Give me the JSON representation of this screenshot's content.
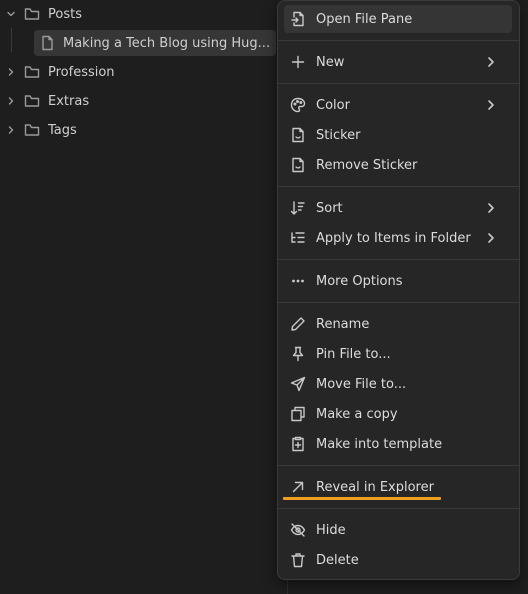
{
  "explorer": {
    "folders": [
      {
        "label": "Posts",
        "expanded": true,
        "icon": "folder-icon"
      },
      {
        "label": "Profession",
        "expanded": false,
        "icon": "folder-icon"
      },
      {
        "label": "Extras",
        "expanded": false,
        "icon": "folder-icon"
      },
      {
        "label": "Tags",
        "expanded": false,
        "icon": "folder-icon"
      }
    ],
    "file": {
      "label": "Making a Tech Blog using Hug...",
      "icon": "file-icon"
    }
  },
  "context_menu": {
    "groups": [
      [
        {
          "label": "Open File Pane",
          "icon": "file-input-icon",
          "highlighted": true
        }
      ],
      [
        {
          "label": "New",
          "icon": "plus-icon",
          "submenu": true
        }
      ],
      [
        {
          "label": "Color",
          "icon": "palette-icon",
          "submenu": true
        },
        {
          "label": "Sticker",
          "icon": "sticker-icon"
        },
        {
          "label": "Remove Sticker",
          "icon": "sticker-icon"
        }
      ],
      [
        {
          "label": "Sort",
          "icon": "sort-icon",
          "submenu": true
        },
        {
          "label": "Apply to Items in Folder",
          "icon": "list-tree-icon",
          "submenu": true
        }
      ],
      [
        {
          "label": "More Options",
          "icon": "more-horizontal-icon"
        }
      ],
      [
        {
          "label": "Rename",
          "icon": "pencil-icon"
        },
        {
          "label": "Pin File to...",
          "icon": "pin-icon"
        },
        {
          "label": "Move File to...",
          "icon": "send-icon"
        },
        {
          "label": "Make a copy",
          "icon": "copy-icon"
        },
        {
          "label": "Make into template",
          "icon": "clipboard-plus-icon"
        }
      ],
      [
        {
          "label": "Reveal in Explorer",
          "icon": "arrow-up-right-icon",
          "underlined": true
        }
      ],
      [
        {
          "label": "Hide",
          "icon": "eye-off-icon"
        },
        {
          "label": "Delete",
          "icon": "trash-icon"
        }
      ]
    ]
  },
  "colors": {
    "background": "#1e1e1e",
    "menu_bg": "#262626",
    "accent_underline": "#f0a020"
  }
}
